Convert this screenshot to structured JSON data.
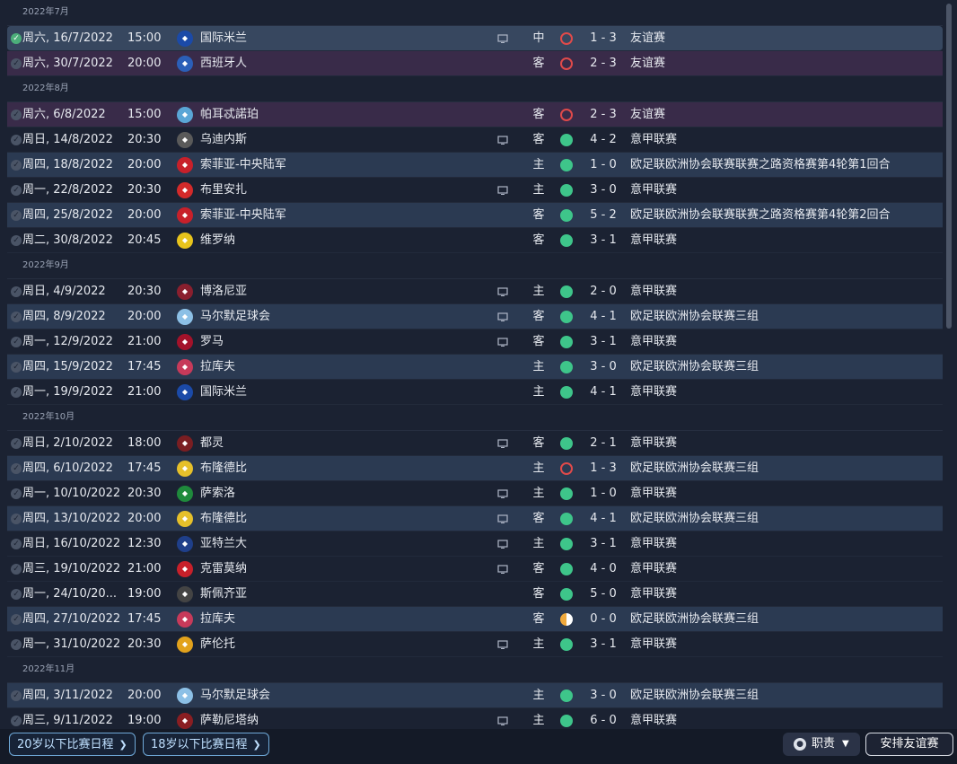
{
  "colors": {
    "win": "#3ec58a",
    "loss": "#e04a4a",
    "draw": "#f0a93c",
    "accent": "#6fa9d8"
  },
  "groups": [
    {
      "month": "2022年7月",
      "matches": [
        {
          "date": "周六, 16/7/2022",
          "time": "15:00",
          "team": "国际米兰",
          "badge": "#1b4aa8",
          "tv": true,
          "venue": "中",
          "result": "loss",
          "score": "1 - 3",
          "comp": "友谊赛",
          "style": "selected"
        },
        {
          "date": "周六, 30/7/2022",
          "time": "20:00",
          "team": "西班牙人",
          "badge": "#2b5fb8",
          "tv": false,
          "venue": "客",
          "result": "loss",
          "score": "2 - 3",
          "comp": "友谊赛",
          "style": "friendly"
        }
      ]
    },
    {
      "month": "2022年8月",
      "matches": [
        {
          "date": "周六, 6/8/2022",
          "time": "15:00",
          "team": "帕耳忒諾珀",
          "badge": "#5aa6d6",
          "tv": false,
          "venue": "客",
          "result": "loss",
          "score": "2 - 3",
          "comp": "友谊赛",
          "style": "friendly"
        },
        {
          "date": "周日, 14/8/2022",
          "time": "20:30",
          "team": "乌迪内斯",
          "badge": "#5a5a5a",
          "tv": true,
          "venue": "客",
          "result": "win",
          "score": "4 - 2",
          "comp": "意甲联赛",
          "style": ""
        },
        {
          "date": "周四, 18/8/2022",
          "time": "20:00",
          "team": "索菲亚-中央陆军",
          "badge": "#c8202a",
          "tv": false,
          "venue": "主",
          "result": "win",
          "score": "1 - 0",
          "comp": "欧足联欧洲协会联赛联赛之路资格赛第4轮第1回合",
          "style": "alt"
        },
        {
          "date": "周一, 22/8/2022",
          "time": "20:30",
          "team": "布里安扎",
          "badge": "#d32a2a",
          "tv": true,
          "venue": "主",
          "result": "win",
          "score": "3 - 0",
          "comp": "意甲联赛",
          "style": ""
        },
        {
          "date": "周四, 25/8/2022",
          "time": "20:00",
          "team": "索菲亚-中央陆军",
          "badge": "#c8202a",
          "tv": false,
          "venue": "客",
          "result": "win",
          "score": "5 - 2",
          "comp": "欧足联欧洲协会联赛联赛之路资格赛第4轮第2回合",
          "style": "alt"
        },
        {
          "date": "周二, 30/8/2022",
          "time": "20:45",
          "team": "维罗纳",
          "badge": "#e8c41c",
          "tv": false,
          "venue": "客",
          "result": "win",
          "score": "3 - 1",
          "comp": "意甲联赛",
          "style": ""
        }
      ]
    },
    {
      "month": "2022年9月",
      "matches": [
        {
          "date": "周日, 4/9/2022",
          "time": "20:30",
          "team": "博洛尼亚",
          "badge": "#8a1f2e",
          "tv": true,
          "venue": "主",
          "result": "win",
          "score": "2 - 0",
          "comp": "意甲联赛",
          "style": ""
        },
        {
          "date": "周四, 8/9/2022",
          "time": "20:00",
          "team": "马尔默足球会",
          "badge": "#8cc0e6",
          "tv": true,
          "venue": "客",
          "result": "win",
          "score": "4 - 1",
          "comp": "欧足联欧洲协会联赛三组",
          "style": "alt"
        },
        {
          "date": "周一, 12/9/2022",
          "time": "21:00",
          "team": "罗马",
          "badge": "#a3122a",
          "tv": true,
          "venue": "客",
          "result": "win",
          "score": "3 - 1",
          "comp": "意甲联赛",
          "style": ""
        },
        {
          "date": "周四, 15/9/2022",
          "time": "17:45",
          "team": "拉库夫",
          "badge": "#c73a5a",
          "tv": false,
          "venue": "主",
          "result": "win",
          "score": "3 - 0",
          "comp": "欧足联欧洲协会联赛三组",
          "style": "alt"
        },
        {
          "date": "周一, 19/9/2022",
          "time": "21:00",
          "team": "国际米兰",
          "badge": "#1b4aa8",
          "tv": false,
          "venue": "主",
          "result": "win",
          "score": "4 - 1",
          "comp": "意甲联赛",
          "style": ""
        }
      ]
    },
    {
      "month": "2022年10月",
      "matches": [
        {
          "date": "周日, 2/10/2022",
          "time": "18:00",
          "team": "都灵",
          "badge": "#7a1e22",
          "tv": true,
          "venue": "客",
          "result": "win",
          "score": "2 - 1",
          "comp": "意甲联赛",
          "style": ""
        },
        {
          "date": "周四, 6/10/2022",
          "time": "17:45",
          "team": "布隆德比",
          "badge": "#e6c02a",
          "tv": false,
          "venue": "主",
          "result": "loss",
          "score": "1 - 3",
          "comp": "欧足联欧洲协会联赛三组",
          "style": "alt"
        },
        {
          "date": "周一, 10/10/2022",
          "time": "20:30",
          "team": "萨索洛",
          "badge": "#1f8a3c",
          "tv": true,
          "venue": "主",
          "result": "win",
          "score": "1 - 0",
          "comp": "意甲联赛",
          "style": ""
        },
        {
          "date": "周四, 13/10/2022",
          "time": "20:00",
          "team": "布隆德比",
          "badge": "#e6c02a",
          "tv": true,
          "venue": "客",
          "result": "win",
          "score": "4 - 1",
          "comp": "欧足联欧洲协会联赛三组",
          "style": "alt"
        },
        {
          "date": "周日, 16/10/2022",
          "time": "12:30",
          "team": "亚特兰大",
          "badge": "#1f3f8a",
          "tv": true,
          "venue": "主",
          "result": "win",
          "score": "3 - 1",
          "comp": "意甲联赛",
          "style": ""
        },
        {
          "date": "周三, 19/10/2022",
          "time": "21:00",
          "team": "克雷莫纳",
          "badge": "#c8202a",
          "tv": true,
          "venue": "客",
          "result": "win",
          "score": "4 - 0",
          "comp": "意甲联赛",
          "style": ""
        },
        {
          "date": "周一, 24/10/20...",
          "time": "19:00",
          "team": "斯佩齐亚",
          "badge": "#444444",
          "tv": false,
          "venue": "客",
          "result": "win",
          "score": "5 - 0",
          "comp": "意甲联赛",
          "style": ""
        },
        {
          "date": "周四, 27/10/2022",
          "time": "17:45",
          "team": "拉库夫",
          "badge": "#c73a5a",
          "tv": false,
          "venue": "客",
          "result": "draw",
          "score": "0 - 0",
          "comp": "欧足联欧洲协会联赛三组",
          "style": "alt"
        },
        {
          "date": "周一, 31/10/2022",
          "time": "20:30",
          "team": "萨伦托",
          "badge": "#e2a21c",
          "tv": true,
          "venue": "主",
          "result": "win",
          "score": "3 - 1",
          "comp": "意甲联赛",
          "style": ""
        }
      ]
    },
    {
      "month": "2022年11月",
      "matches": [
        {
          "date": "周四, 3/11/2022",
          "time": "20:00",
          "team": "马尔默足球会",
          "badge": "#8cc0e6",
          "tv": false,
          "venue": "主",
          "result": "win",
          "score": "3 - 0",
          "comp": "欧足联欧洲协会联赛三组",
          "style": "alt"
        },
        {
          "date": "周三, 9/11/2022",
          "time": "19:00",
          "team": "萨勒尼塔纳",
          "badge": "#8a1e22",
          "tv": true,
          "venue": "主",
          "result": "win",
          "score": "6 - 0",
          "comp": "意甲联赛",
          "style": ""
        }
      ]
    }
  ],
  "bottom": {
    "u20_label": "20岁以下比赛日程",
    "u18_label": "18岁以下比赛日程",
    "duty_label": "职责",
    "arrange_label": "安排友谊赛"
  }
}
